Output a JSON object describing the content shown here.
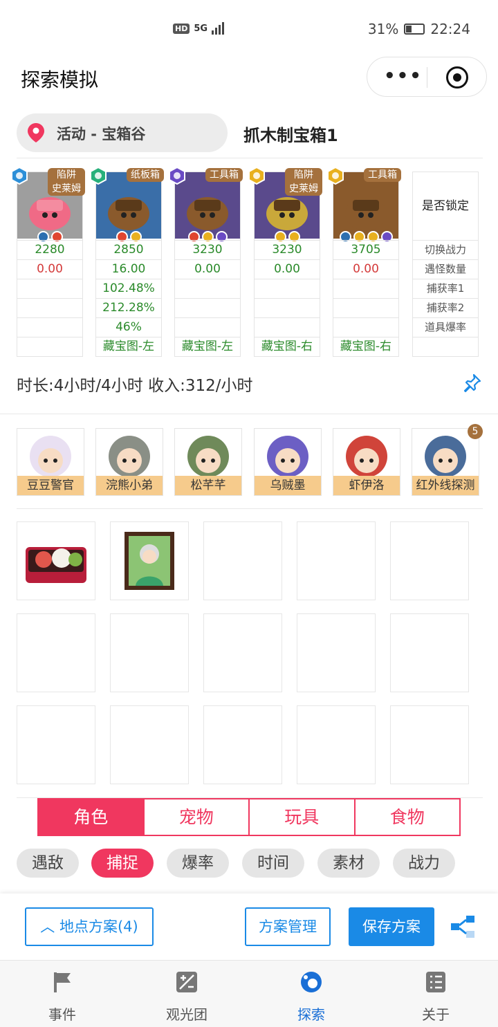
{
  "status_bar": {
    "hd": "HD",
    "signal": "5G",
    "battery": "31%",
    "time": "22:24"
  },
  "header": {
    "title": "探索模拟"
  },
  "location": {
    "label": "活动 - 宝箱谷",
    "title": "抓木制宝箱1"
  },
  "monsters": [
    {
      "tag": "陷阱\n史莱姆",
      "power": "2280",
      "count": "0.00",
      "c1": "",
      "c2": "",
      "drop": "",
      "bonus": "",
      "element": "#2c8fd8",
      "dots": [
        "#2c6fb0",
        "#e0452f"
      ],
      "bg": "#9e9e9e",
      "count_color": "r"
    },
    {
      "tag": "纸板箱",
      "power": "2850",
      "count": "16.00",
      "c1": "102.48%",
      "c2": "212.28%",
      "drop": "46%",
      "bonus": "藏宝图-左",
      "element": "#27b07a",
      "dots": [
        "#e0452f",
        "#e8b01f"
      ],
      "bg": "#3a6ea8",
      "count_color": "g"
    },
    {
      "tag": "工具箱",
      "power": "3230",
      "count": "0.00",
      "c1": "",
      "c2": "",
      "drop": "",
      "bonus": "藏宝图-左",
      "element": "#6a4bc4",
      "dots": [
        "#e0452f",
        "#e8b01f",
        "#6a4bc4"
      ],
      "bg": "#5a4a8c",
      "count_color": "g"
    },
    {
      "tag": "陷阱\n史莱姆",
      "power": "3230",
      "count": "0.00",
      "c1": "",
      "c2": "",
      "drop": "",
      "bonus": "藏宝图-右",
      "element": "#e8b01f",
      "dots": [
        "#e8b01f",
        "#e8b01f"
      ],
      "bg": "#5a4a8c",
      "count_color": "g"
    },
    {
      "tag": "工具箱",
      "power": "3705",
      "count": "0.00",
      "c1": "",
      "c2": "",
      "drop": "",
      "bonus": "藏宝图-右",
      "element": "#e8b01f",
      "dots": [
        "#2c6fb0",
        "#e8b01f",
        "#e8b01f",
        "#6a4bc4"
      ],
      "bg": "#8a5a2c",
      "count_color": "r"
    }
  ],
  "lock_column": {
    "header": "是否锁定",
    "rows": [
      "切换战力",
      "遇怪数量",
      "捕获率1",
      "捕获率2",
      "道具爆率"
    ]
  },
  "summary": "时长:4小时/4小时 收入:312/小时",
  "characters": [
    {
      "name": "豆豆警官",
      "color": "#e9e0f2"
    },
    {
      "name": "浣熊小弟",
      "color": "#8a8f86"
    },
    {
      "name": "松芊芊",
      "color": "#6f8a5a"
    },
    {
      "name": "乌贼墨",
      "color": "#6c5fc4"
    },
    {
      "name": "虾伊洛",
      "color": "#d0443a"
    },
    {
      "name": "红外线探测",
      "color": "#4a6c9a"
    }
  ],
  "item_badge": "5",
  "segment_tabs": [
    "角色",
    "宠物",
    "玩具",
    "食物"
  ],
  "filter_chips": [
    "遇敌",
    "捕捉",
    "爆率",
    "时间",
    "素材",
    "战力"
  ],
  "toolbar": {
    "location_plan": "地点方案(4)",
    "manage": "方案管理",
    "save": "保存方案"
  },
  "tabbar": [
    {
      "label": "事件",
      "icon": "flag-icon"
    },
    {
      "label": "观光团",
      "icon": "plus-minus-icon"
    },
    {
      "label": "探索",
      "icon": "explore-icon"
    },
    {
      "label": "关于",
      "icon": "list-icon"
    }
  ],
  "colors": {
    "accent_red": "#f0375f",
    "accent_blue": "#1a8ae6",
    "green_text": "#2a8a2a",
    "red_text": "#d43a3a",
    "tag_brown": "#a5713d",
    "name_bar": "#f6cb8c"
  }
}
